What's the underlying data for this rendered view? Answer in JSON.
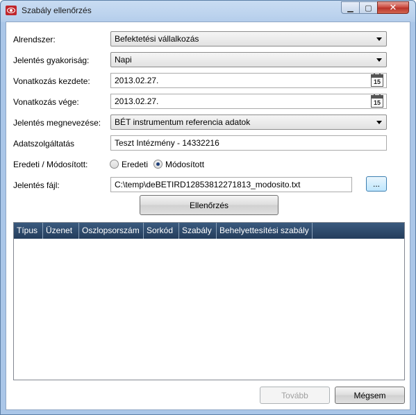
{
  "window": {
    "title": "Szabály ellenőrzés",
    "close_symbol": "✕",
    "min_symbol": "▁",
    "max_symbol": "▢"
  },
  "form": {
    "alrendszer": {
      "label": "Alrendszer:",
      "value": "Befektetési vállalkozás"
    },
    "gyakorisag": {
      "label": "Jelentés gyakoriság:",
      "value": "Napi"
    },
    "kezdete": {
      "label": "Vonatkozás kezdete:",
      "value": "2013.02.27.",
      "cal_day": "15"
    },
    "vege": {
      "label": "Vonatkozás vége:",
      "value": "2013.02.27.",
      "cal_day": "15"
    },
    "megnevezes": {
      "label": "Jelentés megnevezése:",
      "value": "BÉT instrumentum referencia adatok"
    },
    "adatszolgaltatas": {
      "label": "Adatszolgáltatás",
      "value": "Teszt Intézmény - 14332216"
    },
    "eredeti_modositott": {
      "label": "Eredeti / Módosított:",
      "option_eredeti": "Eredeti",
      "option_modositott": "Módosított",
      "selected": "Módosított"
    },
    "fajl": {
      "label": "Jelentés fájl:",
      "value": "C:\\temp\\deBETIRD12853812271813_modosito.txt",
      "browse_label": "..."
    }
  },
  "buttons": {
    "ellenorzes": "Ellenőrzés",
    "tovabb": "Tovább",
    "megsem": "Mégsem"
  },
  "grid": {
    "columns": [
      "Típus",
      "Üzenet",
      "Oszlopsorszám",
      "Sorkód",
      "Szabály",
      "Behelyettesítési szabály"
    ],
    "rows": []
  },
  "colors": {
    "header_bg": "#2f4d70",
    "title_close": "#c9453a"
  }
}
